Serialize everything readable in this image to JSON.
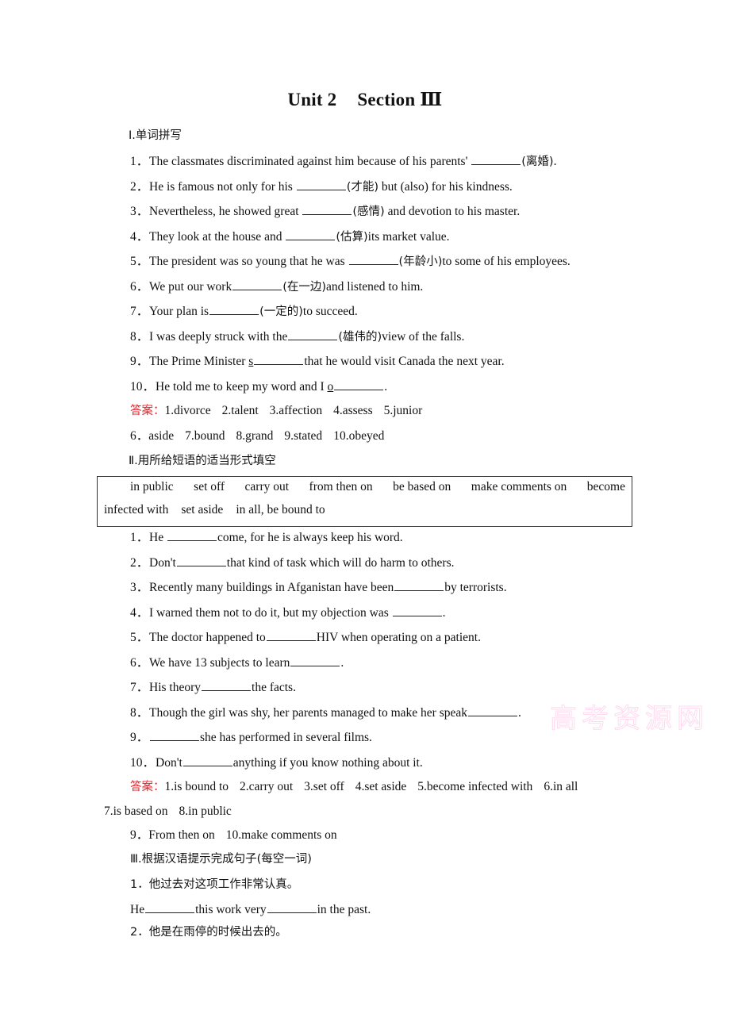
{
  "title": {
    "unit": "Unit 2",
    "section": "Section Ⅲ"
  },
  "part1": {
    "heading": "Ⅰ.单词拼写",
    "items": [
      {
        "num": "1．",
        "before": "The classmates discriminated against him because of his parents' ",
        "hint": "(离婚)",
        "after": "."
      },
      {
        "num": "2．",
        "before": "He is famous not only for his ",
        "hint": "(才能)",
        "after": " but (also) for his kindness."
      },
      {
        "num": "3．",
        "before": "Nevertheless, he showed great ",
        "hint": "(感情)",
        "after": " and devotion to his master."
      },
      {
        "num": "4．",
        "before": "They look at the house and ",
        "hint": "(估算)",
        "after": "its market value."
      },
      {
        "num": "5．",
        "before": "The president was so young that he was ",
        "hint": "(年龄小)",
        "after": "to some of his employees."
      },
      {
        "num": "6．",
        "before": "We put our work",
        "hint": "(在一边)",
        "after": "and listened to him."
      },
      {
        "num": "7．",
        "before": "Your plan is",
        "hint": "(一定的)",
        "after": "to succeed."
      },
      {
        "num": "8．",
        "before": "I was deeply struck with the",
        "hint": "(雄伟的)",
        "after": "view of the falls."
      },
      {
        "num": "9．",
        "before": "The Prime Minister ",
        "initial": "s",
        "after": "that he would visit Canada the next year."
      },
      {
        "num": "10．",
        "before": "He told me to keep my word and I ",
        "initial": "o",
        "after": "."
      }
    ],
    "answer_label": "答案：",
    "answers_line1": [
      "1.divorce",
      "2.talent",
      "3.affection",
      "4.assess",
      "5.junior"
    ],
    "answers_line2": [
      "6．aside",
      "7.bound",
      "8.grand",
      "9.stated",
      "10.obeyed"
    ]
  },
  "part2": {
    "heading": "Ⅱ.用所给短语的适当形式填空",
    "phrases_row1": [
      "in public",
      "set off",
      "carry out",
      "from then on",
      "be based on",
      "make comments on",
      "become"
    ],
    "phrases_row2": [
      "infected with",
      "set aside",
      "in all, be bound to"
    ],
    "items": [
      {
        "num": "1．",
        "before": "He ",
        "after": "come, for he is always keep his word."
      },
      {
        "num": "2．",
        "before": "Don't",
        "after": "that kind of task which will do harm to others."
      },
      {
        "num": "3．",
        "before": "Recently many buildings in Afganistan have been",
        "after": "by terrorists."
      },
      {
        "num": "4．",
        "before": "I warned them not to do it, but my objection was ",
        "after": "."
      },
      {
        "num": "5．",
        "before": "The doctor happened to",
        "after": "HIV when operating on a patient."
      },
      {
        "num": "6．",
        "before": "We have 13 subjects to learn",
        "after": "."
      },
      {
        "num": "7．",
        "before": "His theory",
        "after": "the facts."
      },
      {
        "num": "8．",
        "before": "Though the girl was shy, her parents managed to make her speak",
        "after": "."
      },
      {
        "num": "9．",
        "before": "",
        "after": "she has performed in several films."
      },
      {
        "num": "10．",
        "before": "Don't",
        "after": "anything if you know nothing about it."
      }
    ],
    "answer_label": "答案：",
    "answers_line1": [
      "1.is bound to",
      "2.carry out",
      "3.set off",
      "4.set aside",
      "5.become infected with",
      "6.in all"
    ],
    "answers_line2": [
      "7.is based on",
      "8.in public"
    ],
    "answers_line3": [
      "9．From then on",
      "10.make comments on"
    ]
  },
  "part3": {
    "heading": "Ⅲ.根据汉语提示完成句子(每空一词)",
    "q1_cn": "1．他过去对这项工作非常认真。",
    "q1_en": {
      "a": "He",
      "b": "this work very",
      "c": "in the past."
    },
    "q2_cn": "2．他是在雨停的时候出去的。"
  },
  "watermark": "高考资源网"
}
